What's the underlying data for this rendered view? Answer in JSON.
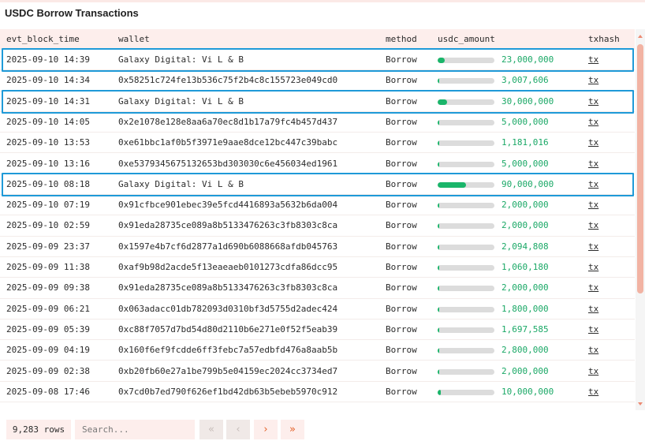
{
  "title": "USDC Borrow Transactions",
  "columns": {
    "time": "evt_block_time",
    "wallet": "wallet",
    "method": "method",
    "amount": "usdc_amount",
    "tx": "txhash"
  },
  "rows": [
    {
      "time": "2025-09-10 14:39",
      "wallet": "Galaxy Digital: Vi L & B",
      "method": "Borrow",
      "amount": "23,000,000",
      "bar_fraction": 0.13,
      "tx": "tx",
      "highlighted": true
    },
    {
      "time": "2025-09-10 14:34",
      "wallet": "0x58251c724fe13b536c75f2b4c8c155723e049cd0",
      "method": "Borrow",
      "amount": "3,007,606",
      "bar_fraction": 0.02,
      "tx": "tx",
      "highlighted": false
    },
    {
      "time": "2025-09-10 14:31",
      "wallet": "Galaxy Digital: Vi L & B",
      "method": "Borrow",
      "amount": "30,000,000",
      "bar_fraction": 0.16,
      "tx": "tx",
      "highlighted": true
    },
    {
      "time": "2025-09-10 14:05",
      "wallet": "0x2e1078e128e8aa6a70ec8d1b17a79fc4b457d437",
      "method": "Borrow",
      "amount": "5,000,000",
      "bar_fraction": 0.03,
      "tx": "tx",
      "highlighted": false
    },
    {
      "time": "2025-09-10 13:53",
      "wallet": "0xe61bbc1af0b5f3971e9aae8dce12bc447c39babc",
      "method": "Borrow",
      "amount": "1,181,016",
      "bar_fraction": 0.01,
      "tx": "tx",
      "highlighted": false
    },
    {
      "time": "2025-09-10 13:16",
      "wallet": "0xe5379345675132653bd303030c6e456034ed1961",
      "method": "Borrow",
      "amount": "5,000,000",
      "bar_fraction": 0.03,
      "tx": "tx",
      "highlighted": false
    },
    {
      "time": "2025-09-10 08:18",
      "wallet": "Galaxy Digital: Vi L & B",
      "method": "Borrow",
      "amount": "90,000,000",
      "bar_fraction": 0.5,
      "tx": "tx",
      "highlighted": true
    },
    {
      "time": "2025-09-10 07:19",
      "wallet": "0x91cfbce901ebec39e5fcd4416893a5632b6da004",
      "method": "Borrow",
      "amount": "2,000,000",
      "bar_fraction": 0.01,
      "tx": "tx",
      "highlighted": false
    },
    {
      "time": "2025-09-10 02:59",
      "wallet": "0x91eda28735ce089a8b5133476263c3fb8303c8ca",
      "method": "Borrow",
      "amount": "2,000,000",
      "bar_fraction": 0.01,
      "tx": "tx",
      "highlighted": false
    },
    {
      "time": "2025-09-09 23:37",
      "wallet": "0x1597e4b7cf6d2877a1d690b6088668afdb045763",
      "method": "Borrow",
      "amount": "2,094,808",
      "bar_fraction": 0.01,
      "tx": "tx",
      "highlighted": false
    },
    {
      "time": "2025-09-09 11:38",
      "wallet": "0xaf9b98d2acde5f13eaeaeb0101273cdfa86dcc95",
      "method": "Borrow",
      "amount": "1,060,180",
      "bar_fraction": 0.01,
      "tx": "tx",
      "highlighted": false
    },
    {
      "time": "2025-09-09 09:38",
      "wallet": "0x91eda28735ce089a8b5133476263c3fb8303c8ca",
      "method": "Borrow",
      "amount": "2,000,000",
      "bar_fraction": 0.01,
      "tx": "tx",
      "highlighted": false
    },
    {
      "time": "2025-09-09 06:21",
      "wallet": "0x063adacc01db782093d0310bf3d5755d2adec424",
      "method": "Borrow",
      "amount": "1,800,000",
      "bar_fraction": 0.01,
      "tx": "tx",
      "highlighted": false
    },
    {
      "time": "2025-09-09 05:39",
      "wallet": "0xc88f7057d7bd54d80d2110b6e271e0f52f5eab39",
      "method": "Borrow",
      "amount": "1,697,585",
      "bar_fraction": 0.01,
      "tx": "tx",
      "highlighted": false
    },
    {
      "time": "2025-09-09 04:19",
      "wallet": "0x160f6ef9fcdde6ff3febc7a57edbfd476a8aab5b",
      "method": "Borrow",
      "amount": "2,800,000",
      "bar_fraction": 0.02,
      "tx": "tx",
      "highlighted": false
    },
    {
      "time": "2025-09-09 02:38",
      "wallet": "0xb20fb60e27a1be799b5e04159ec2024cc3734ed7",
      "method": "Borrow",
      "amount": "2,000,000",
      "bar_fraction": 0.01,
      "tx": "tx",
      "highlighted": false
    },
    {
      "time": "2025-09-08 17:46",
      "wallet": "0x7cd0b7ed790f626ef1bd42db63b5ebeb5970c912",
      "method": "Borrow",
      "amount": "10,000,000",
      "bar_fraction": 0.06,
      "tx": "tx",
      "highlighted": false
    }
  ],
  "footer": {
    "row_count": "9,283 rows",
    "search_placeholder": "Search..."
  },
  "pagination": {
    "first_icon": "double-chevron-left-icon",
    "prev_icon": "chevron-left-icon",
    "next_icon": "chevron-right-icon",
    "last_icon": "double-chevron-right-icon"
  },
  "colors": {
    "accent": "#e4622a",
    "header_bg": "#fdeeec",
    "bar_fill": "#1ab56a",
    "amount_text": "#1aa866",
    "highlight_border": "#1f9ad8"
  }
}
